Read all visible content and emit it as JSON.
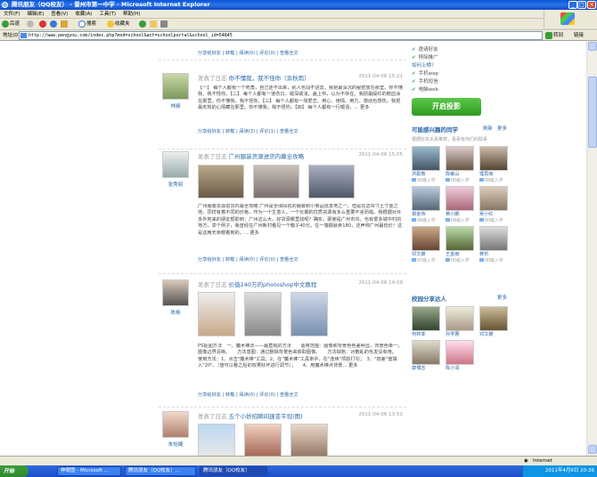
{
  "window": {
    "title": "腾讯朋友（QQ校友） - 雷州市第一中学 - Microsoft Internet Explorer"
  },
  "menu": [
    "文件(F)",
    "编辑(E)",
    "查看(V)",
    "收藏(A)",
    "工具(T)",
    "帮助(H)"
  ],
  "toolbar": {
    "back": "后退",
    "search": "搜索",
    "favorites": "收藏夹"
  },
  "address": {
    "label": "地址(D)",
    "url": "http://www.pengyou.com/index.php?mod=school&act=schoolportal&school_id=54845",
    "go": "转到",
    "links": "链接"
  },
  "feeds": [
    {
      "prefix": "发表了日志",
      "title": "你不懂我，我不怪你（余秋雨）",
      "date": "2011-04-06 15:21",
      "user": "林娴",
      "body": "【一】 每个人都有一个死角，自己走不出来，别人也闯不进去。我把最深沉的秘密放在那里。你不懂我，我不怪你。【二】 每个人都有一道伤口，或深或浅，盖上布，以为不存在。我把最殷红的鲜血涂在那里。你不懂我，我不怪你。【三】 每个人都有一场爱恋，用心、用情、用力，感动也感伤。我把最炙热的心情藏在那里。你不懂我，我不怪你。【四】 每个人都有一行眼泪，... 更多",
      "actions": "分享给好友 | 转载 | 阅读(3) | 评论(1) | 查看全文"
    },
    {
      "prefix": "发表了日志",
      "title": "广州服装货源进货内幕全攻略",
      "date": "2011-04-06 15:05",
      "user": "张秀丽",
      "body": "广州服装货源进货内幕全攻略 广州是全球闻名的服装和小商品批发地之一。但是在这块寸土寸金之地，同样有着不同的价格，作为一个生意人，一个长期的优质货源有多么重要不言而喻。我根据对许多外地来的朋友帮助到：广州这么大，好货源哪里找呢？确实，即使是广州市内，也有很多城中村的地方，举个例子，我曾经在广州新村看见一个箱子40元，在一墙隔就卖180，还声称广州最低价！这是这两天亲眼看到的。... 更多",
      "actions": "分享给好友 | 转载 | 阅读(0) | 评论(0) | 查看全文"
    },
    {
      "prefix": "发表了日志",
      "title": "价值240万的photoshop中文教程",
      "date": "2011-04-06 14:09",
      "user": "陈杨",
      "body": "PS抠图方法　一、魔术棒法——最直观的方法　　适用范围：图像和背景色色差明显，背景色单一，图像边界清晰。　　方法意图：通过删除背景色来获取图像。　　方法缺陷：对散乱的毛发没有用。　　使用方法：1、点击\"魔术棒\"工具；2、在\"魔术棒\"工具条中，在\"连续\"项前打勾；　3、\"容差\"值填入\"20\"。（值可以看之后的效果好坏进行调节）；　　4、用魔术棒点背景... 更多",
      "actions": "分享给好友 | 转载 | 阅读(0) | 评论(0) | 查看全文"
    },
    {
      "prefix": "发表了日志",
      "title": "五个小妙招瞬间速变平坦(图)",
      "date": "2011-04-06 13:52",
      "user": "朱怡婕"
    }
  ],
  "top_actions": "分享给好友 | 转载 | 阅读(0) | 评论(0) | 查看全文",
  "sidebar": {
    "checks": [
      "邀请好友",
      "移除推广",
      "如何上榜？",
      "手机wap",
      "手机短信",
      "电脑web"
    ],
    "button": "开启投影",
    "interest_title": "可能感兴趣的同学",
    "refresh": "刷新",
    "more": "更多",
    "interest_desc": "根据好友关系推荐，看看有你们的联系",
    "people": [
      {
        "name": "洪勤熊",
        "sub": "00级入学"
      },
      {
        "name": "陈敏山",
        "sub": "00级入学"
      },
      {
        "name": "理思雨",
        "sub": "09级入学"
      },
      {
        "name": "谢金伟",
        "sub": "06级入学"
      },
      {
        "name": "黄小鹏",
        "sub": "09级入学"
      },
      {
        "name": "吴小红",
        "sub": "00级入学"
      },
      {
        "name": "邓文媛",
        "sub": "07级入学"
      },
      {
        "name": "王金雨",
        "sub": "00级入学"
      },
      {
        "name": "黄忻",
        "sub": "00级入学"
      }
    ],
    "share_title": "校园分享达人",
    "share_more": "更多",
    "sharers": [
      {
        "name": "何林季"
      },
      {
        "name": "孙学蕙"
      },
      {
        "name": "邓文媛"
      },
      {
        "name": "康博志"
      },
      {
        "name": "陈小清"
      }
    ]
  },
  "status": {
    "zone": "Internet"
  },
  "taskbar": {
    "start": "开始",
    "tasks": [
      "神眼图 - Microsoft ...",
      "腾讯朋友（QQ校友）...",
      "腾讯朋友（QQ校友）"
    ],
    "date": "2011年4月6日",
    "time": "20:36"
  }
}
